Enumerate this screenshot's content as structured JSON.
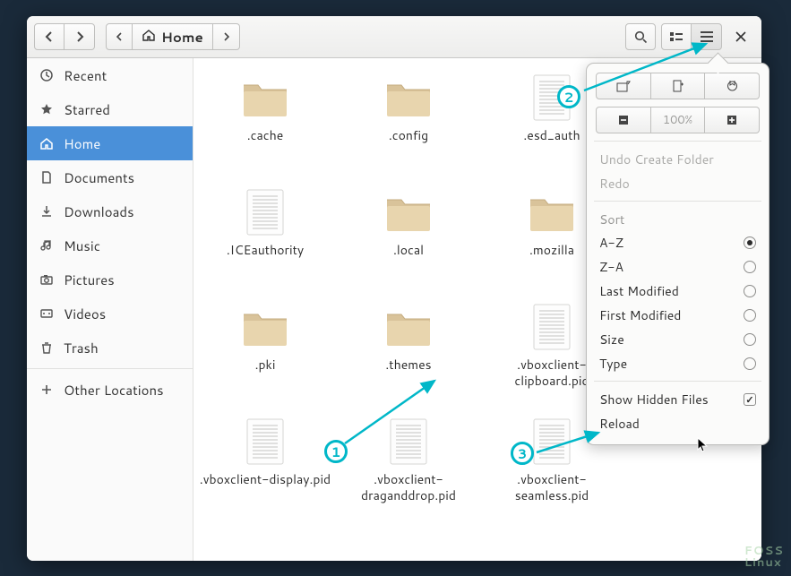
{
  "location": {
    "label": "Home"
  },
  "sidebar": {
    "items": [
      {
        "label": "Recent",
        "icon": "clock"
      },
      {
        "label": "Starred",
        "icon": "star"
      },
      {
        "label": "Home",
        "icon": "home",
        "selected": true
      },
      {
        "label": "Documents",
        "icon": "document"
      },
      {
        "label": "Downloads",
        "icon": "download"
      },
      {
        "label": "Music",
        "icon": "music"
      },
      {
        "label": "Pictures",
        "icon": "camera"
      },
      {
        "label": "Videos",
        "icon": "video"
      },
      {
        "label": "Trash",
        "icon": "trash"
      }
    ],
    "other": "Other Locations"
  },
  "files": [
    {
      "name": ".cache",
      "type": "folder"
    },
    {
      "name": ".config",
      "type": "folder"
    },
    {
      "name": ".esd_auth",
      "type": "text"
    },
    {
      "name": ".ICEauthority",
      "type": "text"
    },
    {
      "name": ".local",
      "type": "folder"
    },
    {
      "name": ".mozilla",
      "type": "folder"
    },
    {
      "name": ".pki",
      "type": "folder"
    },
    {
      "name": ".themes",
      "type": "folder"
    },
    {
      "name": ".vboxclient-clipboard.pid",
      "type": "text"
    },
    {
      "name": ".vboxclient-display.pid",
      "type": "text"
    },
    {
      "name": ".vboxclient-draganddrop.pid",
      "type": "text"
    },
    {
      "name": ".vboxclient-seamless.pid",
      "type": "text"
    }
  ],
  "popover": {
    "zoom": "100%",
    "undo": "Undo Create Folder",
    "redo": "Redo",
    "sortLabel": "Sort",
    "sort": [
      {
        "label": "A-Z",
        "on": true
      },
      {
        "label": "Z-A",
        "on": false
      },
      {
        "label": "Last Modified",
        "on": false
      },
      {
        "label": "First Modified",
        "on": false
      },
      {
        "label": "Size",
        "on": false
      },
      {
        "label": "Type",
        "on": false
      }
    ],
    "showHidden": {
      "label": "Show Hidden Files",
      "on": true
    },
    "reload": "Reload"
  },
  "annotations": {
    "one": "1",
    "two": "2",
    "three": "3"
  },
  "watermark": {
    "line1": "FOSS",
    "line2": "Linux"
  }
}
